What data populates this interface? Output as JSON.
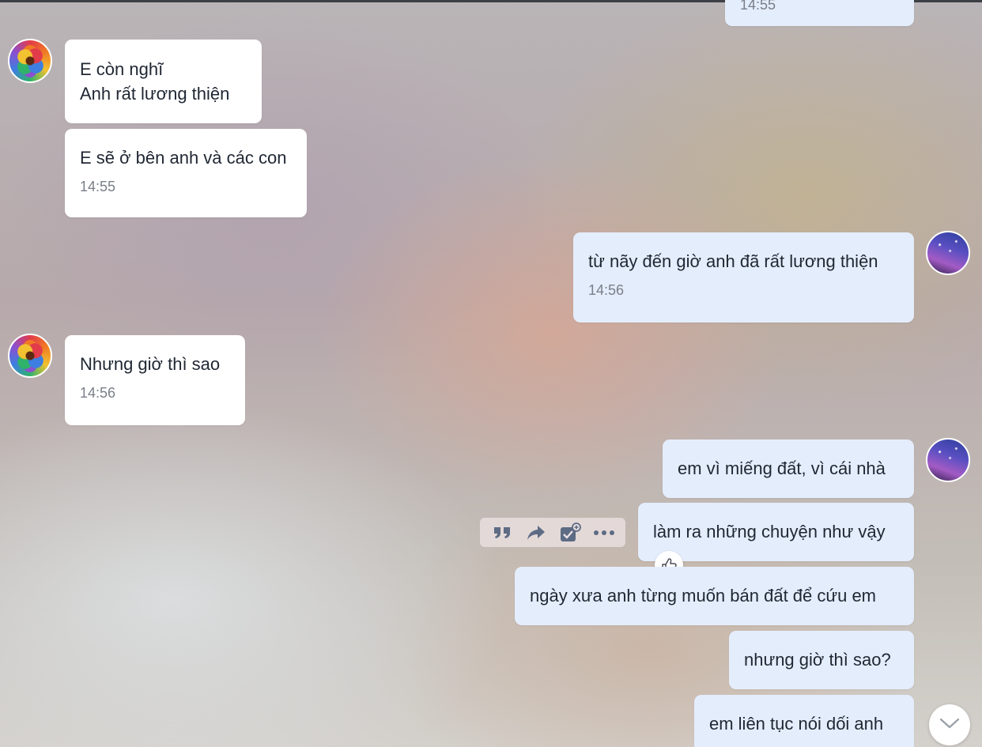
{
  "top_partial_time": "14:55",
  "messages": [
    {
      "sender": "other",
      "lines": [
        "E còn nghĩ",
        "Anh rất lương thiện"
      ]
    },
    {
      "sender": "other",
      "text": "E sẽ ở bên anh và các con",
      "time": "14:55"
    },
    {
      "sender": "me",
      "text": "từ nãy đến giờ anh đã rất lương thiện",
      "time": "14:56"
    },
    {
      "sender": "other",
      "text": "Nhưng giờ thì sao",
      "time": "14:56"
    },
    {
      "sender": "me",
      "text": "em vì miếng đất, vì cái nhà"
    },
    {
      "sender": "me",
      "text": "làm ra những chuyện như vậy"
    },
    {
      "sender": "me",
      "text": "ngày xưa anh từng muốn bán đất để cứu em"
    },
    {
      "sender": "me",
      "text": "nhưng giờ thì sao?"
    },
    {
      "sender": "me",
      "text": "em liên tục nói dối anh"
    }
  ],
  "message_toolbar": {
    "icons": [
      "quote-icon",
      "forward-icon",
      "task-icon",
      "more-icon"
    ]
  },
  "reaction_icon": "thumbs-up-icon",
  "scroll_button_icon": "chevron-down-icon",
  "colors": {
    "incoming_bubble": "#ffffff",
    "outgoing_bubble": "#e4edfc",
    "time_text": "#7a7f88",
    "toolbar_icon": "#5d6b84"
  }
}
